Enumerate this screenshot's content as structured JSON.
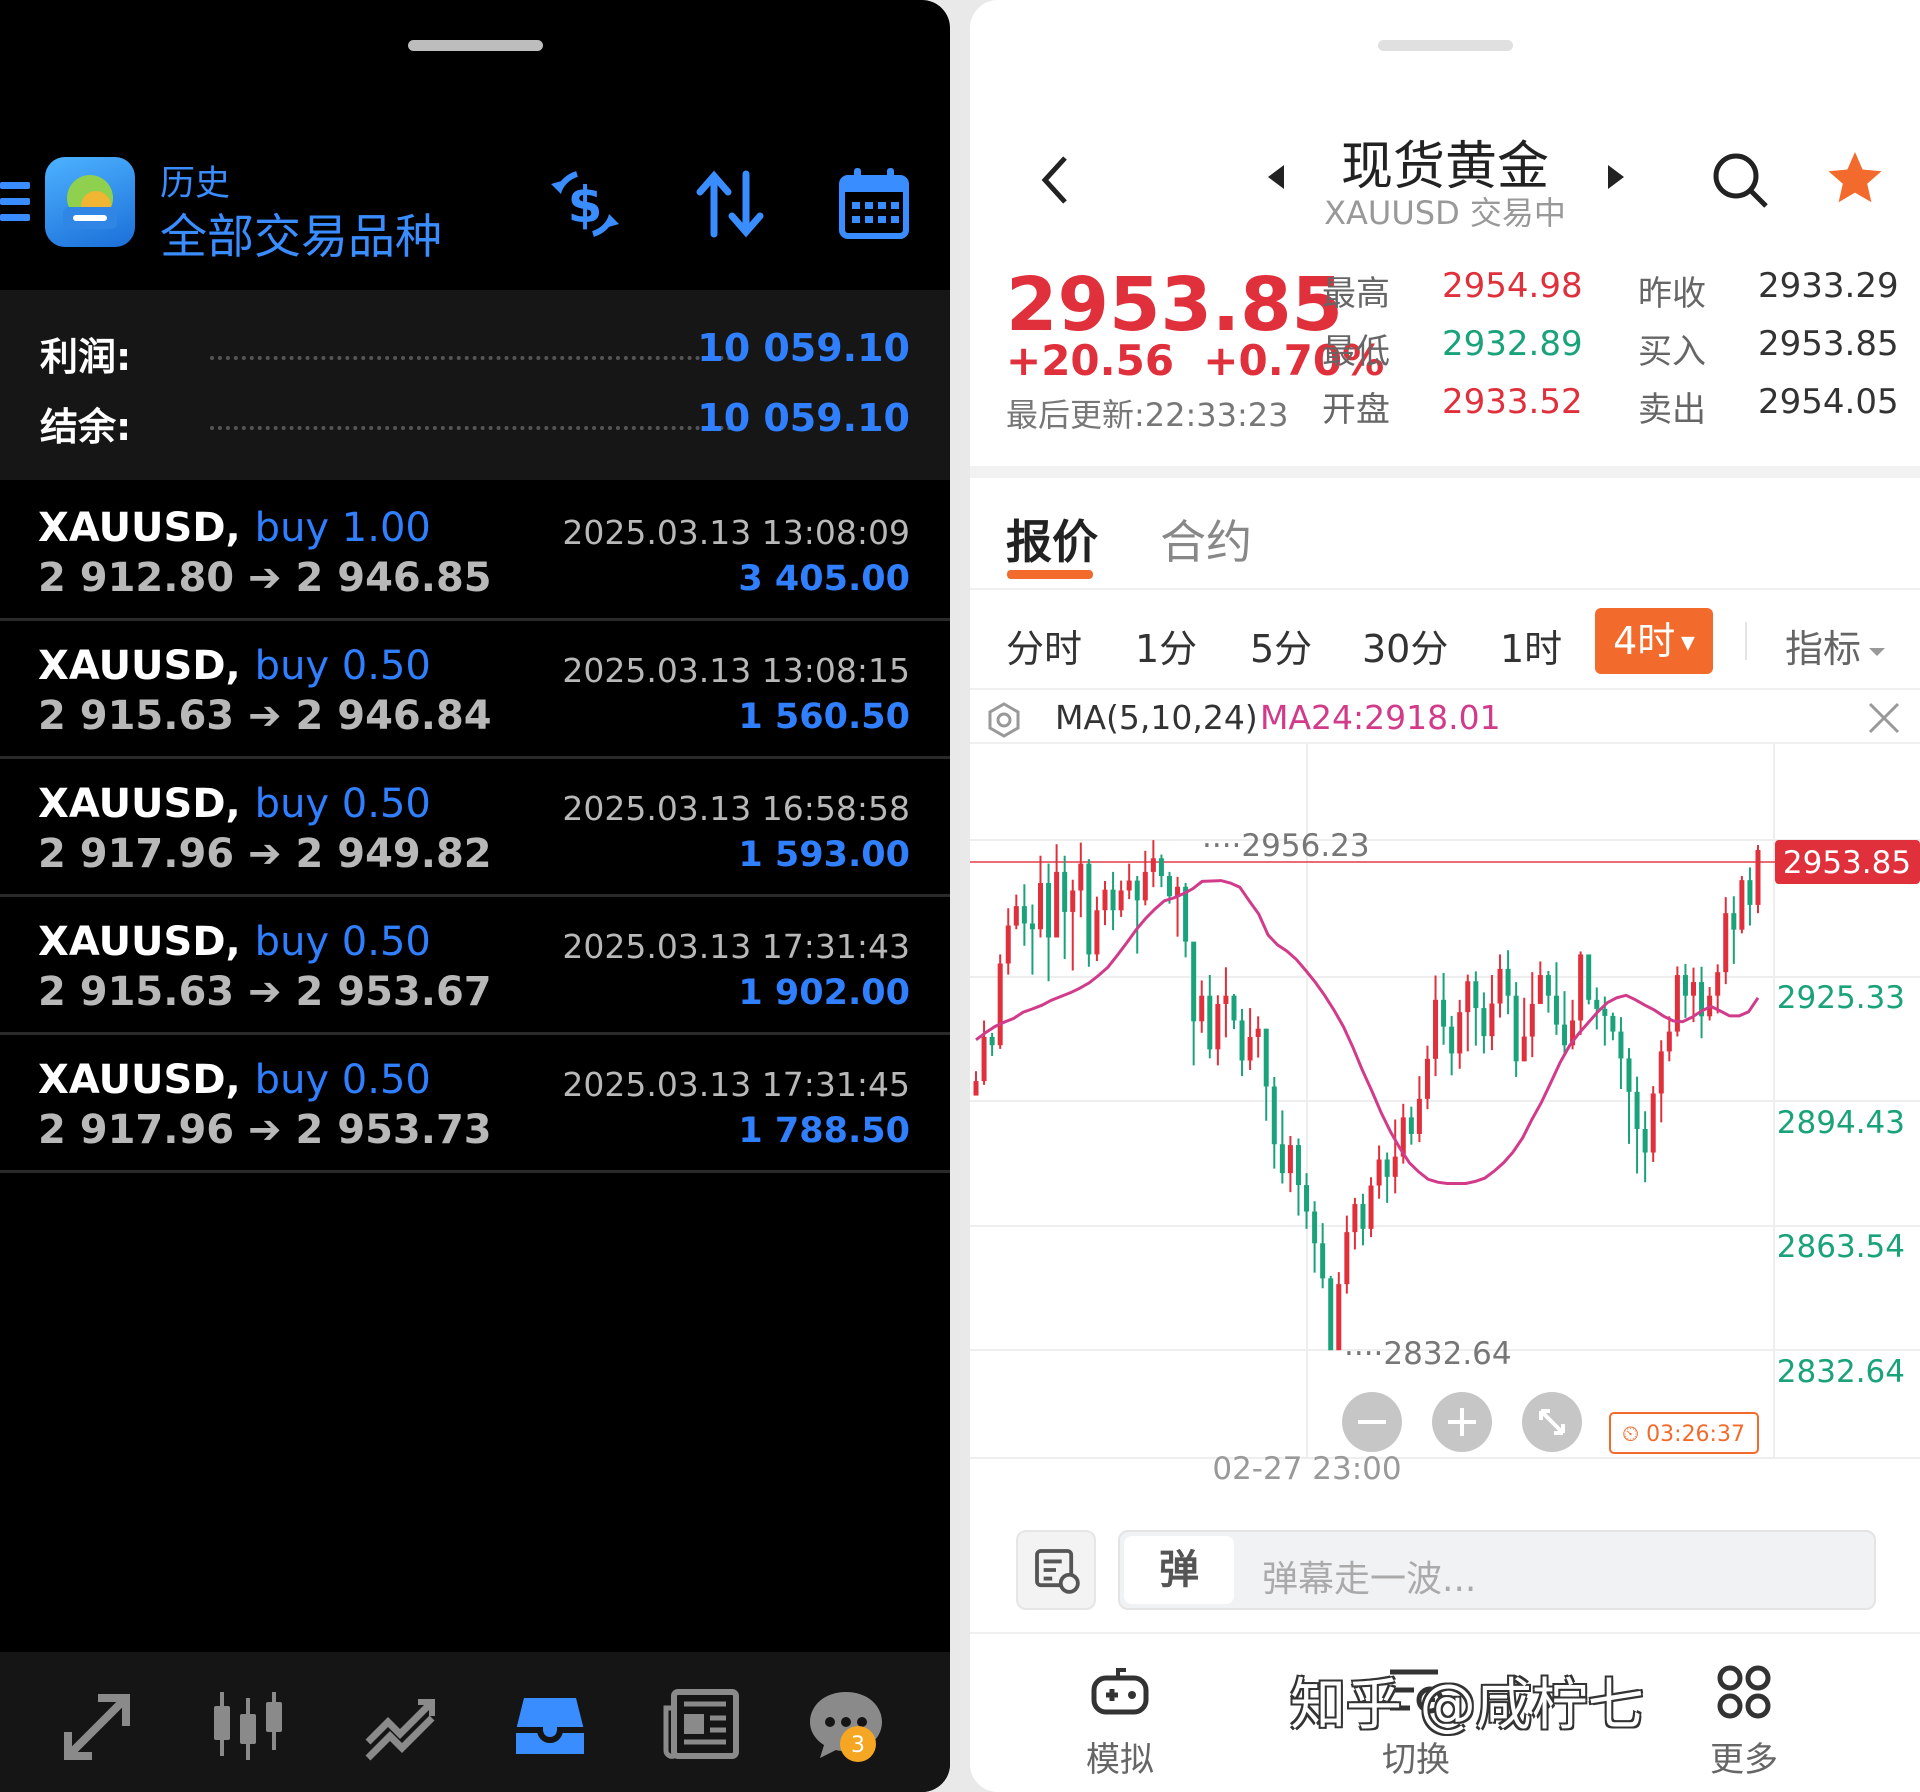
{
  "mt4": {
    "header": {
      "subtitle": "历史",
      "title": "全部交易品种"
    },
    "summary": [
      {
        "label": "利润:",
        "value": "10 059.10"
      },
      {
        "label": "结余:",
        "value": "10 059.10"
      }
    ],
    "trades": [
      {
        "symbol": "XAUUSD,",
        "side": "buy 1.00",
        "open": "2 912.80",
        "close": "2 946.85",
        "time": "2025.03.13 13:08:09",
        "profit": "3 405.00"
      },
      {
        "symbol": "XAUUSD,",
        "side": "buy 0.50",
        "open": "2 915.63",
        "close": "2 946.84",
        "time": "2025.03.13 13:08:15",
        "profit": "1 560.50"
      },
      {
        "symbol": "XAUUSD,",
        "side": "buy 0.50",
        "open": "2 917.96",
        "close": "2 949.82",
        "time": "2025.03.13 16:58:58",
        "profit": "1 593.00"
      },
      {
        "symbol": "XAUUSD,",
        "side": "buy 0.50",
        "open": "2 915.63",
        "close": "2 953.67",
        "time": "2025.03.13 17:31:43",
        "profit": "1 902.00"
      },
      {
        "symbol": "XAUUSD,",
        "side": "buy 0.50",
        "open": "2 917.96",
        "close": "2 953.73",
        "time": "2025.03.13 17:31:45",
        "profit": "1 788.50"
      }
    ],
    "nav_badge": "3",
    "icons": [
      "menu-icon",
      "currency-exchange-icon",
      "sort-icon",
      "calendar-icon",
      "quotes-icon",
      "chart-icon",
      "trade-icon",
      "history-icon",
      "news-icon",
      "chat-icon"
    ],
    "colors": {
      "accent": "#2f7fff",
      "bg": "#000000"
    }
  },
  "quote": {
    "title": "现货黄金",
    "subtitle": "XAUUSD 交易中",
    "price": "2953.85",
    "change": "+20.56",
    "change_pct": "+0.70%",
    "updated": "最后更新:22:33:23",
    "stats": [
      {
        "label": "最高",
        "value": "2954.98"
      },
      {
        "label": "最低",
        "value": "2932.89"
      },
      {
        "label": "开盘",
        "value": "2933.52"
      },
      {
        "label": "昨收",
        "value": "2933.29"
      },
      {
        "label": "买入",
        "value": "2953.85"
      },
      {
        "label": "卖出",
        "value": "2954.05"
      }
    ],
    "tabs": [
      "报价",
      "合约"
    ],
    "periods": [
      "分时",
      "1分",
      "5分",
      "30分",
      "1时",
      "4时",
      "指标"
    ],
    "indicator": {
      "name": "MA(5,10,24)",
      "value": "MA24:2918.01"
    },
    "composer_badge": "弹",
    "composer_placeholder": "弹幕走一波...",
    "nav": [
      "模拟",
      "切换",
      "更多"
    ],
    "watermark": "知乎 @咸柠七",
    "colors": {
      "up": "#e0303c",
      "down": "#1aa37a",
      "accent": "#f36b2c",
      "ma": "#d23a8a"
    }
  },
  "chart_data": {
    "type": "candlestick",
    "interval": "4时",
    "y_ticks": [
      "2925.33",
      "2894.43",
      "2863.54",
      "2832.64"
    ],
    "ylim": [
      2832.64,
      2956.23
    ],
    "last_price": "2953.85",
    "high_label": "2956.23",
    "low_label": "2832.64",
    "x_label": "02-27 23:00",
    "countdown": "03:26:37",
    "series": [
      {
        "name": "MA24",
        "values": [
          2907.8,
          2909.5,
          2911,
          2912.1,
          2913,
          2914.5,
          2915.3,
          2916.2,
          2917.4,
          2918.3,
          2919.2,
          2920.3,
          2921.6,
          2923.4,
          2925.4,
          2928.3,
          2931.3,
          2934.5,
          2937.2,
          2939.5,
          2941.5,
          2942.2,
          2943.2,
          2944.4,
          2946.2,
          2946.3,
          2946.4,
          2945.8,
          2944.8,
          2941.5,
          2938.3,
          2933.2,
          2930.8,
          2929.3,
          2927.3,
          2924.6,
          2921.8,
          2918.6,
          2915,
          2911,
          2906,
          2900.5,
          2895.5,
          2890.2,
          2885.5,
          2881.5,
          2878,
          2875.8,
          2874,
          2873.3,
          2873,
          2873,
          2873,
          2873.5,
          2874.3,
          2876,
          2878,
          2880.6,
          2884,
          2888.5,
          2892.6,
          2897.4,
          2902.3,
          2906.4,
          2909.4,
          2912,
          2914.6,
          2916.8,
          2918,
          2918.6,
          2917.5,
          2916.2,
          2915,
          2913.5,
          2912.4,
          2912.2,
          2913.3,
          2914.8,
          2915.9,
          2914.8,
          2913.6,
          2913.6,
          2914.6,
          2918
        ]
      }
    ],
    "candles": [
      [
        2894.3,
        2897.8,
        2900.2,
        2894.5
      ],
      [
        2897.8,
        2908.5,
        2912.5,
        2896.9
      ],
      [
        2908.5,
        2906.5,
        2909.5,
        2903.9
      ],
      [
        2906.5,
        2926.3,
        2928.5,
        2905.6
      ],
      [
        2926.3,
        2935.5,
        2939.7,
        2923.6
      ],
      [
        2935.5,
        2940.2,
        2943,
        2934.6
      ],
      [
        2940.2,
        2936,
        2945.5,
        2930.6
      ],
      [
        2936,
        2934.6,
        2940.6,
        2923.6
      ],
      [
        2934.6,
        2945.8,
        2952.4,
        2932.6
      ],
      [
        2945.8,
        2932.6,
        2950.5,
        2922
      ],
      [
        2932.6,
        2948.5,
        2955.2,
        2932.6
      ],
      [
        2948.5,
        2938.8,
        2952.4,
        2927.4
      ],
      [
        2938.8,
        2944,
        2946.6,
        2924.6
      ],
      [
        2944,
        2950.5,
        2955.6,
        2937.5
      ],
      [
        2950.5,
        2928.5,
        2951.6,
        2925.5
      ],
      [
        2928.5,
        2939.2,
        2942.5,
        2926.9
      ],
      [
        2939.2,
        2944.2,
        2946.3,
        2935.6
      ],
      [
        2944.2,
        2939.2,
        2948.5,
        2934.4
      ],
      [
        2939.2,
        2944,
        2946.4,
        2937.6
      ],
      [
        2944,
        2946.4,
        2950.5,
        2941.9
      ],
      [
        2946.4,
        2941.6,
        2947.5,
        2928.7
      ],
      [
        2941.6,
        2948.5,
        2953.6,
        2940.4
      ],
      [
        2948.5,
        2951.8,
        2956.2,
        2944.8
      ],
      [
        2951.8,
        2947.5,
        2952.7,
        2944.8
      ],
      [
        2947.5,
        2942.6,
        2948.5,
        2940.8
      ],
      [
        2942.6,
        2944.9,
        2947.3,
        2932.8
      ],
      [
        2944.9,
        2931.6,
        2945.8,
        2927.8
      ],
      [
        2931.6,
        2912.3,
        2931.5,
        2901.6
      ],
      [
        2912.3,
        2918.5,
        2922.2,
        2909.5
      ],
      [
        2918.5,
        2905.5,
        2923.5,
        2903.3
      ],
      [
        2905.5,
        2916.5,
        2918.6,
        2901.6
      ],
      [
        2916.5,
        2918.5,
        2925.4,
        2908.4
      ],
      [
        2918.5,
        2912.5,
        2918.9,
        2910.4
      ],
      [
        2912.5,
        2902.8,
        2915.3,
        2899
      ],
      [
        2902.8,
        2908.5,
        2915.5,
        2900.5
      ],
      [
        2908.5,
        2910.5,
        2913.5,
        2903.5
      ],
      [
        2910.5,
        2896.5,
        2910.5,
        2888.2
      ],
      [
        2896.5,
        2882.5,
        2898.8,
        2876.6
      ],
      [
        2882.5,
        2875.5,
        2890.7,
        2873
      ],
      [
        2875.5,
        2882.3,
        2884.5,
        2870.9
      ],
      [
        2882.3,
        2872.6,
        2883.9,
        2865.2
      ],
      [
        2872.6,
        2866.2,
        2875.5,
        2862
      ],
      [
        2866.2,
        2858.5,
        2868.7,
        2851.4
      ],
      [
        2858.5,
        2850,
        2863.4,
        2847.6
      ],
      [
        2850,
        2832.6,
        2850.6,
        2832.6
      ],
      [
        2832.6,
        2848.6,
        2851.5,
        2832.6
      ],
      [
        2848.6,
        2861.2,
        2865.2,
        2846.3
      ],
      [
        2861.2,
        2868,
        2869.5,
        2857
      ],
      [
        2868,
        2862,
        2870.5,
        2858
      ],
      [
        2862,
        2872.5,
        2874.5,
        2860
      ],
      [
        2872.5,
        2878.8,
        2882.2,
        2869.3
      ],
      [
        2878.8,
        2874.6,
        2880.5,
        2868.3
      ],
      [
        2874.6,
        2879.5,
        2888.5,
        2870.6
      ],
      [
        2879.5,
        2889,
        2892.3,
        2877.8
      ],
      [
        2889,
        2885,
        2891.6,
        2882.4
      ],
      [
        2885,
        2893.5,
        2899,
        2883
      ],
      [
        2893.5,
        2903.2,
        2906.4,
        2891
      ],
      [
        2903.2,
        2917.5,
        2923.4,
        2899
      ],
      [
        2917.5,
        2911,
        2924,
        2906.6
      ],
      [
        2911,
        2904.5,
        2913.6,
        2899.2
      ],
      [
        2904.5,
        2914.5,
        2917.5,
        2900.8
      ],
      [
        2914.5,
        2922,
        2923.6,
        2905
      ],
      [
        2922,
        2915.5,
        2924.4,
        2906.4
      ],
      [
        2915.5,
        2908.7,
        2919.3,
        2904.5
      ],
      [
        2908.7,
        2916.6,
        2923.5,
        2905.3
      ],
      [
        2916.6,
        2925,
        2928.5,
        2913.2
      ],
      [
        2925,
        2918.5,
        2929.5,
        2914
      ],
      [
        2918.5,
        2902.6,
        2921.8,
        2898.8
      ],
      [
        2902.6,
        2908.6,
        2918,
        2902.6
      ],
      [
        2908.6,
        2916.5,
        2924.2,
        2903.6
      ],
      [
        2916.5,
        2923.5,
        2926.8,
        2917.2
      ],
      [
        2923.5,
        2918.5,
        2924.5,
        2914.4
      ],
      [
        2918.5,
        2911.5,
        2926.6,
        2909
      ],
      [
        2911.5,
        2906.5,
        2919.6,
        2904.6
      ],
      [
        2906.5,
        2912.5,
        2917.5,
        2905.5
      ],
      [
        2912.5,
        2928.5,
        2929.2,
        2909
      ],
      [
        2928.5,
        2917.5,
        2927.6,
        2916.4
      ],
      [
        2917.5,
        2915.3,
        2920.5,
        2910.3
      ],
      [
        2915.3,
        2913.6,
        2918.3,
        2906.4
      ],
      [
        2913.6,
        2909.8,
        2914.4,
        2907.7
      ],
      [
        2909.8,
        2903.3,
        2913.3,
        2895.9
      ],
      [
        2903.3,
        2895.2,
        2905.8,
        2882.6
      ],
      [
        2895.2,
        2886.2,
        2898.9,
        2875.4
      ],
      [
        2886.2,
        2880.5,
        2890.5,
        2873.3
      ],
      [
        2880.5,
        2894.8,
        2896.6,
        2878.2
      ],
      [
        2894.8,
        2905,
        2907.7,
        2887.8
      ],
      [
        2905,
        2909.8,
        2913.5,
        2902.6
      ],
      [
        2909.8,
        2923.5,
        2925.6,
        2908.6
      ],
      [
        2923.5,
        2918.5,
        2926.2,
        2913.1
      ],
      [
        2918.5,
        2921.8,
        2925.3,
        2912.1
      ],
      [
        2921.8,
        2913.5,
        2925.5,
        2908.2
      ],
      [
        2913.5,
        2918.5,
        2920.6,
        2912.5
      ],
      [
        2918.5,
        2924.2,
        2926.1,
        2914.2
      ],
      [
        2924.2,
        2938.5,
        2942.4,
        2921.3
      ],
      [
        2938.5,
        2934.5,
        2942.6,
        2926.2
      ],
      [
        2934.5,
        2946.5,
        2947.5,
        2933.6
      ],
      [
        2946.5,
        2940.5,
        2949.6,
        2935.5
      ],
      [
        2940.5,
        2953.8,
        2955,
        2938.5
      ]
    ]
  }
}
